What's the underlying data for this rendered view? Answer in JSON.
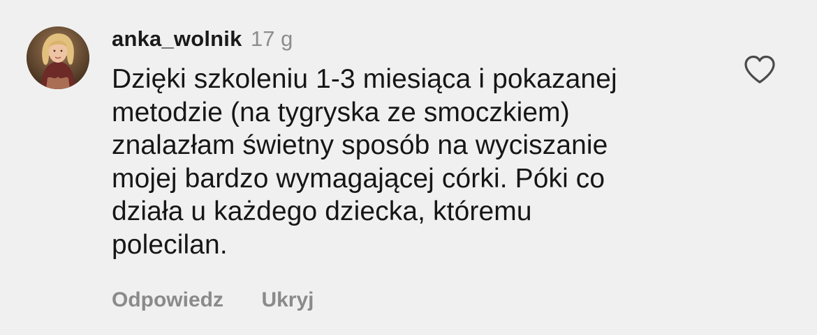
{
  "comment": {
    "username": "anka_wolnik",
    "timestamp": "17 g",
    "text_lines": [
      "Dzięki szkoleniu 1-3 miesiąca i pokazanej",
      "metodzie (na tygryska ze smoczkiem)",
      "znalazłam świetny sposób na wyciszanie",
      "mojej bardzo wymagającej córki. Póki co",
      "działa u każdego dziecka, któremu",
      "polecilan."
    ],
    "actions": {
      "reply_label": "Odpowiedz",
      "hide_label": "Ukryj"
    },
    "avatar_icon": "user-avatar-photo",
    "like_icon": "heart-outline-icon"
  },
  "colors": {
    "background": "#f0f0f0",
    "text": "#161616",
    "muted": "#8a8a8a"
  }
}
